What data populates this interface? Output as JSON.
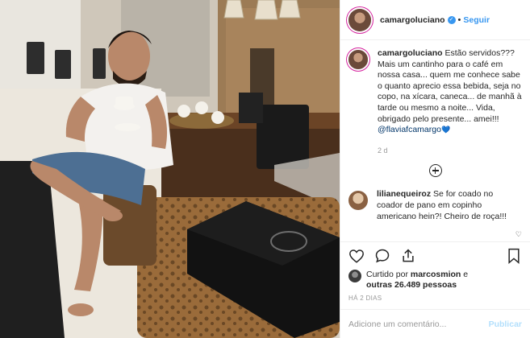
{
  "header": {
    "username": "camargoluciano",
    "separator": "•",
    "follow_label": "Seguir",
    "verified_icon": "verified-badge-icon"
  },
  "caption": {
    "username": "camargoluciano",
    "text": "Estão servidos??? Mais um cantinho para o café em nossa casa... quem me conhece sabe o quanto aprecio essa bebida, seja no copo, na xícara, caneca... de manhã à tarde ou mesmo a noite... Vida, obrigado pelo presente... amei!!!",
    "mention": "@flaviafcamargo",
    "emoji": "💙",
    "timestamp": "2 d"
  },
  "comment": {
    "username": "lilianequeiroz",
    "text": "Se for coado no coador de pano em copinho americano hein?! Cheiro de roça!!!"
  },
  "likes": {
    "prefix": "Curtido por",
    "user": "marcosmion",
    "conjunction": "e",
    "others": "outras 26.489 pessoas"
  },
  "post_time": "HÁ 2 DIAS",
  "add_comment": {
    "placeholder": "Adicione um comentário...",
    "publish_label": "Publicar"
  },
  "colors": {
    "link_blue": "#3897f0",
    "publish_disabled": "#b2dffc",
    "meta_gray": "#999999"
  }
}
